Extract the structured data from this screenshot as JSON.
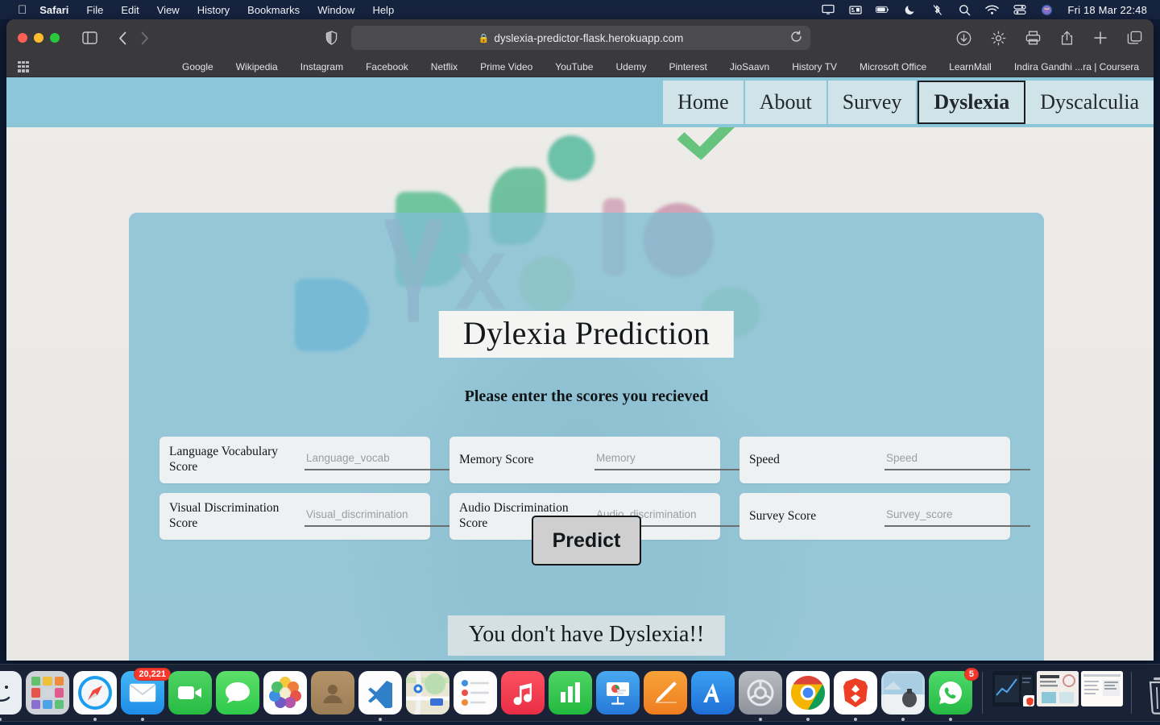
{
  "menubar": {
    "apple_icon": "apple-icon",
    "items": [
      {
        "label": "Safari",
        "bold": true
      },
      {
        "label": "File",
        "bold": false
      },
      {
        "label": "Edit",
        "bold": false
      },
      {
        "label": "View",
        "bold": false
      },
      {
        "label": "History",
        "bold": false
      },
      {
        "label": "Bookmarks",
        "bold": false
      },
      {
        "label": "Window",
        "bold": false
      },
      {
        "label": "Help",
        "bold": false
      }
    ],
    "status_icons": [
      "display-icon",
      "keyboard-icon",
      "battery-icon",
      "do-not-disturb-moon-icon",
      "bluetooth-off-icon",
      "spotlight-search-icon",
      "wifi-icon",
      "control-center-icon",
      "siri-icon"
    ],
    "clock": "Fri 18 Mar  22:48"
  },
  "browser": {
    "traffic_lights": [
      "close",
      "minimize",
      "zoom"
    ],
    "sidebar_icon": "sidebar-toggle-icon",
    "back_icon": "back-arrow-icon",
    "forward_icon": "forward-arrow-icon",
    "shield_icon": "privacy-shield-icon",
    "url": "dyslexia-predictor-flask.herokuapp.com",
    "url_lock_icon": "lock-icon",
    "reload_icon": "reload-icon",
    "right_icons": [
      "downloads-icon",
      "extensions-gear-icon",
      "print-icon",
      "share-icon",
      "new-tab-plus-icon",
      "tab-overview-icon"
    ],
    "bookmarks": [
      "Google",
      "Wikipedia",
      "Instagram",
      "Facebook",
      "Netflix",
      "Prime Video",
      "YouTube",
      "Udemy",
      "Pinterest",
      "JioSaavn",
      "History TV",
      "Microsoft Office",
      "LearnMall",
      "Indira Gandhi ...ra | Coursera"
    ]
  },
  "site": {
    "nav": [
      {
        "label": "Home",
        "active": false
      },
      {
        "label": "About",
        "active": false
      },
      {
        "label": "Survey",
        "active": false
      },
      {
        "label": "Dyslexia",
        "active": true
      },
      {
        "label": "Dyscalculia",
        "active": false
      }
    ],
    "title": "Dylexia Prediction",
    "subtitle": "Please enter the scores you recieved",
    "fields": [
      {
        "label": "Language Vocabulary Score",
        "placeholder": "Language_vocab",
        "value": ""
      },
      {
        "label": "Memory Score",
        "placeholder": "Memory",
        "value": ""
      },
      {
        "label": "Speed",
        "placeholder": "Speed",
        "value": ""
      },
      {
        "label": "Visual Discrimination Score",
        "placeholder": "Visual_discrimination",
        "value": ""
      },
      {
        "label": "Audio Discrimination Score",
        "placeholder": "Audio_discrimination",
        "value": ""
      },
      {
        "label": "Survey Score",
        "placeholder": "Survey_score",
        "value": ""
      }
    ],
    "predict_button": "Predict",
    "result": "You don't have Dyslexia!!",
    "colors": {
      "nav_bar": "#8cc6d9",
      "nav_tab": "#cfe3e8",
      "card": "#81bed3",
      "result_box": "#d4e0e3",
      "button": "#cfcfcf"
    }
  },
  "dock": {
    "items": [
      {
        "name": "finder",
        "badge": "",
        "running": true
      },
      {
        "name": "launchpad",
        "badge": "",
        "running": false
      },
      {
        "name": "safari",
        "badge": "",
        "running": true
      },
      {
        "name": "mail",
        "badge": "20,221",
        "running": true
      },
      {
        "name": "facetime",
        "badge": "",
        "running": false
      },
      {
        "name": "messages",
        "badge": "",
        "running": false
      },
      {
        "name": "photos",
        "badge": "",
        "running": false
      },
      {
        "name": "contacts",
        "badge": "",
        "running": false
      },
      {
        "name": "vscode",
        "badge": "",
        "running": true
      },
      {
        "name": "maps",
        "badge": "",
        "running": false
      },
      {
        "name": "reminders",
        "badge": "",
        "running": false
      },
      {
        "name": "music",
        "badge": "",
        "running": false
      },
      {
        "name": "numbers",
        "badge": "",
        "running": false
      },
      {
        "name": "keynote",
        "badge": "",
        "running": false
      },
      {
        "name": "freeform",
        "badge": "",
        "running": false
      },
      {
        "name": "app-store",
        "badge": "",
        "running": false
      },
      {
        "name": "system-settings",
        "badge": "",
        "running": true
      },
      {
        "name": "chrome",
        "badge": "",
        "running": true
      },
      {
        "name": "brave",
        "badge": "",
        "running": true
      },
      {
        "name": "preview",
        "badge": "",
        "running": true
      },
      {
        "name": "whatsapp",
        "badge": "5",
        "running": true
      }
    ],
    "minimized": [
      "window-preview-1",
      "window-preview-2",
      "window-preview-3"
    ],
    "trash": "trash-icon"
  }
}
